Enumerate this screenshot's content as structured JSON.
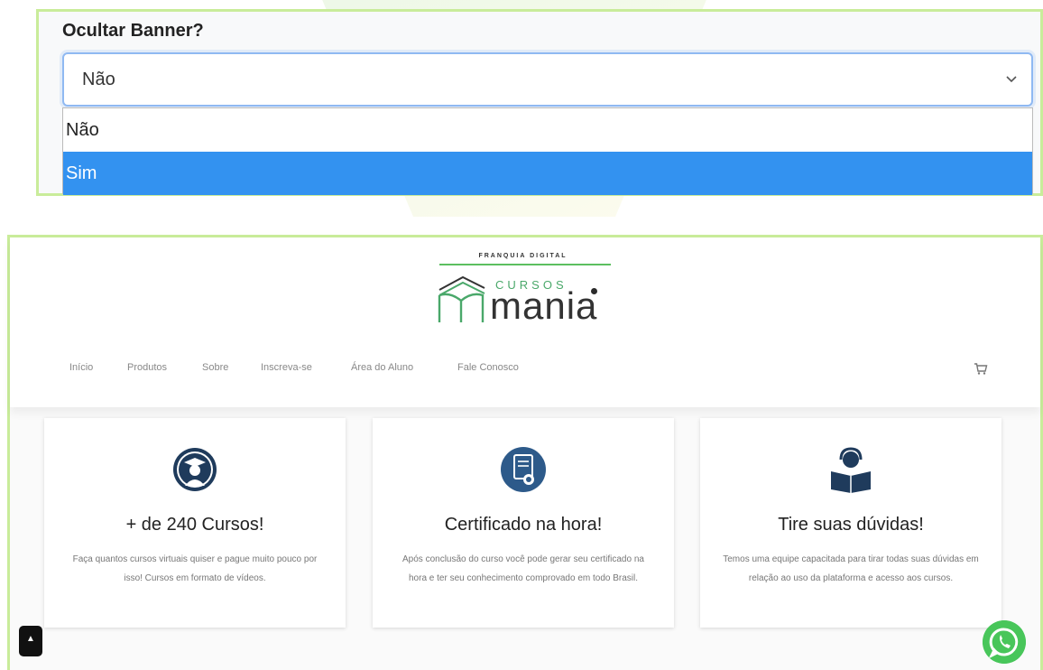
{
  "select": {
    "label": "Ocultar Banner?",
    "value": "Não",
    "options": [
      {
        "label": "Não",
        "highlighted": false
      },
      {
        "label": "Sim",
        "highlighted": true
      }
    ],
    "highlight_color": "#3392f0"
  },
  "site": {
    "logo": {
      "tagline": "FRANQUIA DIGITAL",
      "small_word": "CURSOS",
      "brand": "mania"
    },
    "nav": [
      "Início",
      "Produtos",
      "Sobre",
      "Inscreva-se",
      "Área do Aluno",
      "Fale Conosco"
    ],
    "cards": [
      {
        "icon": "graduate-icon",
        "title": "+ de 240 Cursos!",
        "text": "Faça quantos cursos virtuais quiser e pague muito pouco por isso! Cursos em formato de vídeos."
      },
      {
        "icon": "certificate-icon",
        "title": "Certificado na hora!",
        "text": "Após conclusão do curso você pode gerar seu certificado na hora e ter seu conhecimento comprovado em todo Brasil."
      },
      {
        "icon": "support-reader-icon",
        "title": "Tire suas dúvidas!",
        "text": "Temos uma equipe capacitada para tirar todas suas dúvidas em relação ao uso da plataforma e acesso aos cursos."
      }
    ],
    "colors": {
      "brand_green": "#4aa86a",
      "icon_navy": "#1f3b5c",
      "whatsapp": "#48c65a"
    }
  }
}
